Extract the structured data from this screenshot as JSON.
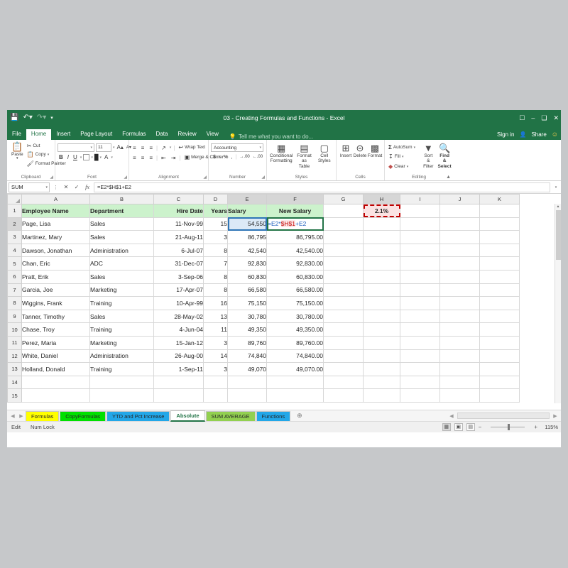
{
  "window": {
    "title": "03 - Creating Formulas and Functions - Excel",
    "quick_access": [
      "save-icon",
      "undo-icon",
      "redo-icon",
      "customize-qat-icon"
    ],
    "controls": [
      "ribbon-display-options-icon",
      "minimize-icon",
      "restore-icon",
      "close-icon"
    ],
    "sign_in": "Sign in",
    "share": "Share"
  },
  "ribbon_tabs": [
    {
      "label": "File",
      "active": false
    },
    {
      "label": "Home",
      "active": true
    },
    {
      "label": "Insert",
      "active": false
    },
    {
      "label": "Page Layout",
      "active": false
    },
    {
      "label": "Formulas",
      "active": false
    },
    {
      "label": "Data",
      "active": false
    },
    {
      "label": "Review",
      "active": false
    },
    {
      "label": "View",
      "active": false
    }
  ],
  "tell_me": "Tell me what you want to do...",
  "ribbon": {
    "clipboard": {
      "label": "Clipboard",
      "paste": "Paste",
      "cut": "Cut",
      "copy": "Copy",
      "format_painter": "Format Painter"
    },
    "font": {
      "label": "Font",
      "font_name": "",
      "font_size": "11",
      "grow_font": "A",
      "shrink_font": "A",
      "bold": "B",
      "italic": "I",
      "underline": "U",
      "borders": "borders-icon",
      "fill_color": "fill-color-icon",
      "font_color": "A"
    },
    "alignment": {
      "label": "Alignment",
      "wrap_text": "Wrap Text",
      "merge_center": "Merge & Center",
      "orientation": "orientation-icon"
    },
    "number": {
      "label": "Number",
      "format": "Accounting",
      "currency": "$",
      "percent": "%",
      "comma": ",",
      "increase_decimal": ".00",
      "decrease_decimal": ".00"
    },
    "styles": {
      "label": "Styles",
      "conditional_formatting": "Conditional Formatting",
      "format_as_table": "Format as Table",
      "cell_styles": "Cell Styles"
    },
    "cells": {
      "label": "Cells",
      "insert": "Insert",
      "delete": "Delete",
      "format": "Format"
    },
    "editing": {
      "label": "Editing",
      "autosum": "AutoSum",
      "fill": "Fill",
      "clear": "Clear",
      "sort_filter": "Sort & Filter",
      "find_select": "Find & Select"
    }
  },
  "formula_bar": {
    "name_box": "SUM",
    "cancel": "✕",
    "enter": "✓",
    "insert_function": "fx",
    "formula": "=E2*$H$1+E2"
  },
  "grid": {
    "columns": [
      "A",
      "B",
      "C",
      "D",
      "E",
      "F",
      "G",
      "H",
      "I",
      "J",
      "K"
    ],
    "rows": [
      "1",
      "2",
      "3",
      "4",
      "5",
      "6",
      "7",
      "8",
      "9",
      "10",
      "11",
      "12",
      "13",
      "14",
      "15"
    ],
    "headers": {
      "A": "Employee Name",
      "B": "Department",
      "C": "Hire Date",
      "D": "Years",
      "E": "Salary",
      "F": "New Salary"
    },
    "h1_value": "2.1%",
    "f2_formula": {
      "part1": "=E2*",
      "part2": "$H$1",
      "part3": "+E2"
    },
    "data": [
      {
        "name": "Page, Lisa",
        "dept": "Sales",
        "hire": "11-Nov-99",
        "years": "15",
        "salary": "54,550",
        "new_salary": ""
      },
      {
        "name": "Martinez, Mary",
        "dept": "Sales",
        "hire": "21-Aug-11",
        "years": "3",
        "salary": "86,795",
        "new_salary": "86,795.00"
      },
      {
        "name": "Dawson, Jonathan",
        "dept": "Administration",
        "hire": "6-Jul-07",
        "years": "8",
        "salary": "42,540",
        "new_salary": "42,540.00"
      },
      {
        "name": "Chan, Eric",
        "dept": "ADC",
        "hire": "31-Dec-07",
        "years": "7",
        "salary": "92,830",
        "new_salary": "92,830.00"
      },
      {
        "name": "Pratt, Erik",
        "dept": "Sales",
        "hire": "3-Sep-06",
        "years": "8",
        "salary": "60,830",
        "new_salary": "60,830.00"
      },
      {
        "name": "Garcia, Joe",
        "dept": "Marketing",
        "hire": "17-Apr-07",
        "years": "8",
        "salary": "66,580",
        "new_salary": "66,580.00"
      },
      {
        "name": "Wiggins, Frank",
        "dept": "Training",
        "hire": "10-Apr-99",
        "years": "16",
        "salary": "75,150",
        "new_salary": "75,150.00"
      },
      {
        "name": "Tanner, Timothy",
        "dept": "Sales",
        "hire": "28-May-02",
        "years": "13",
        "salary": "30,780",
        "new_salary": "30,780.00"
      },
      {
        "name": "Chase, Troy",
        "dept": "Training",
        "hire": "4-Jun-04",
        "years": "11",
        "salary": "49,350",
        "new_salary": "49,350.00"
      },
      {
        "name": "Perez, Maria",
        "dept": "Marketing",
        "hire": "15-Jan-12",
        "years": "3",
        "salary": "89,760",
        "new_salary": "89,760.00"
      },
      {
        "name": "White, Daniel",
        "dept": "Administration",
        "hire": "26-Aug-00",
        "years": "14",
        "salary": "74,840",
        "new_salary": "74,840.00"
      },
      {
        "name": "Holland, Donald",
        "dept": "Training",
        "hire": "1-Sep-11",
        "years": "3",
        "salary": "49,070",
        "new_salary": "49,070.00"
      }
    ]
  },
  "sheet_tabs": [
    {
      "label": "Formulas",
      "color": "#ffff00",
      "active": false
    },
    {
      "label": "CopyFormulas",
      "color": "#00e000",
      "active": false
    },
    {
      "label": "YTD and Pct Increase",
      "color": "#22a7e8",
      "active": false
    },
    {
      "label": "Absolute",
      "color": "#ffffff",
      "active": true
    },
    {
      "label": "SUM AVERAGE",
      "color": "#92d050",
      "active": false
    },
    {
      "label": "Functions",
      "color": "#22a7e8",
      "active": false
    }
  ],
  "add_sheet": "⊕",
  "status_bar": {
    "mode": "Edit",
    "num_lock": "Num Lock",
    "views": [
      "normal-view-icon",
      "page-layout-view-icon",
      "page-break-preview-icon"
    ],
    "zoom_out": "−",
    "zoom_in": "+",
    "zoom_level": "115%"
  }
}
